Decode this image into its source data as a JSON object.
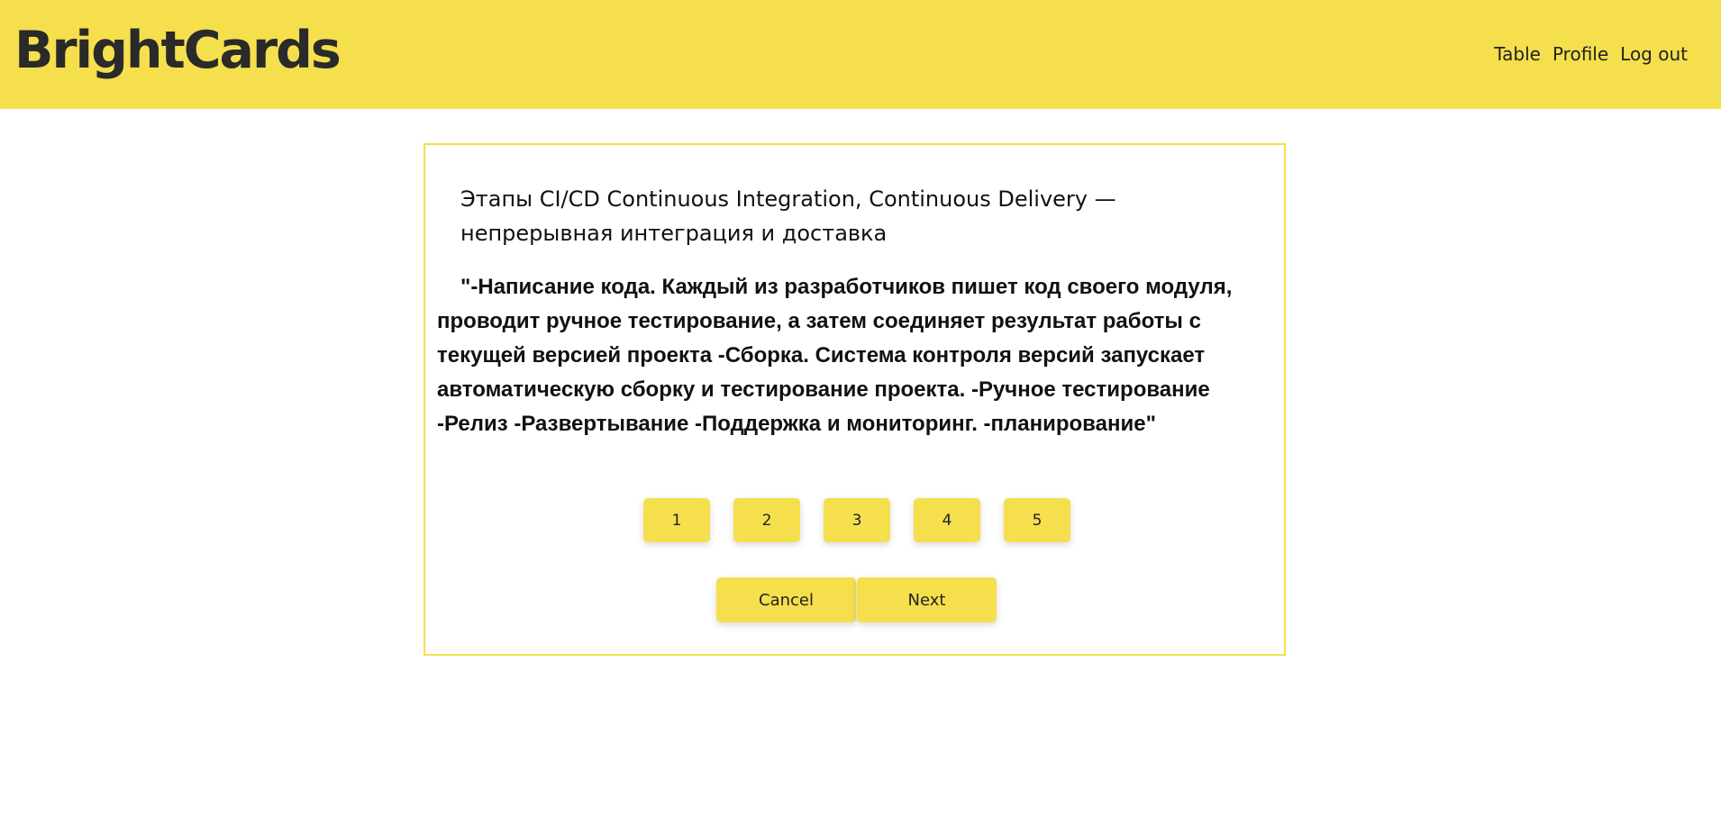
{
  "header": {
    "logo": "BrightCards",
    "nav": [
      "Table",
      "Profile",
      "Log out"
    ]
  },
  "card": {
    "question": "Этапы CI/CD Continuous Integration, Continuous Delivery — непрерывная интеграция и доставка",
    "answer": "\"-Написание кода. Каждый из разработчиков пишет код своего модуля, проводит ручное тестирование, а затем соединяет результат работы с текущей версией проекта -Сборка. Система контроля версий запускает автоматическую сборку и тестирование проекта. -Ручное тестирование -Релиз -Развертывание -Поддержка и мониторинг. -планирование\"",
    "ratings": [
      "1",
      "2",
      "3",
      "4",
      "5"
    ],
    "cancel_label": "Cancel",
    "next_label": "Next"
  },
  "colors": {
    "accent": "#f5df4d",
    "text": "#111111"
  }
}
